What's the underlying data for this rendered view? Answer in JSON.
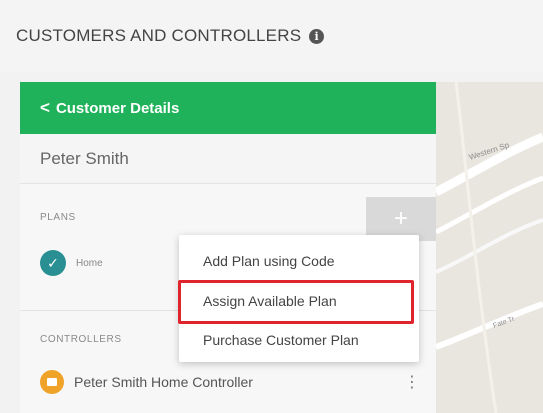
{
  "page": {
    "title": "CUSTOMERS AND CONTROLLERS",
    "info_glyph": "i"
  },
  "panel": {
    "back_glyph": "<",
    "header_title": "Customer Details",
    "customer_name": "Peter Smith",
    "accent_color": "#20b25a"
  },
  "plans": {
    "section_label": "PLANS",
    "add_glyph": "+",
    "items": [
      {
        "name": "Home",
        "status_glyph": "✓"
      }
    ]
  },
  "controllers": {
    "section_label": "CONTROLLERS",
    "items": [
      {
        "name": "Peter Smith Home Controller",
        "more_glyph": "⋮"
      }
    ]
  },
  "menu": {
    "items": [
      {
        "label": "Add Plan using Code"
      },
      {
        "label": "Assign Available Plan",
        "highlighted": true
      },
      {
        "label": "Purchase Customer Plan"
      }
    ],
    "highlight_color": "#e0242e"
  },
  "map": {
    "street_labels": [
      "Western Sp",
      "Fate Tr"
    ]
  }
}
